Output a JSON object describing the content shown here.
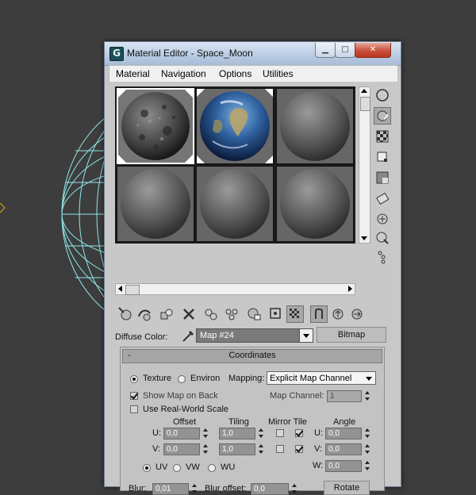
{
  "window": {
    "title": "Material Editor - Space_Moon",
    "icon_name": "3ds-max-app-icon"
  },
  "menu": [
    "Material",
    "Navigation",
    "Options",
    "Utilities"
  ],
  "slots": [
    {
      "kind": "moon",
      "selected": true
    },
    {
      "kind": "earth",
      "selected": false
    },
    {
      "kind": "gray",
      "selected": false
    },
    {
      "kind": "gray",
      "selected": false
    },
    {
      "kind": "gray",
      "selected": false
    },
    {
      "kind": "gray",
      "selected": false
    }
  ],
  "diffuse": {
    "label": "Diffuse Color:",
    "map_value": "Map #24",
    "bitmap_label": "Bitmap"
  },
  "coordinates": {
    "title": "Coordinates",
    "collapse_symbol": "-",
    "texture_label": "Texture",
    "environ_label": "Environ",
    "mapping_label": "Mapping:",
    "mapping_value": "Explicit Map Channel",
    "show_map_label": "Show Map on Back",
    "real_world_label": "Use Real-World Scale",
    "map_channel_label": "Map Channel:",
    "map_channel_value": "1",
    "headers": {
      "offset": "Offset",
      "tiling": "Tiling",
      "mirror_tile": "Mirror Tile",
      "angle": "Angle"
    },
    "u_label": "U:",
    "v_label": "V:",
    "w_label": "W:",
    "offset_u": "0,0",
    "offset_v": "0,0",
    "tiling_u": "1,0",
    "tiling_v": "1,0",
    "angle_u": "0,0",
    "angle_v": "0,0",
    "angle_w": "0,0",
    "mirror_u": false,
    "tile_u": true,
    "mirror_v": false,
    "tile_v": true,
    "uv_label": "UV",
    "vw_label": "VW",
    "wu_label": "WU",
    "blur_label": "Blur:",
    "blur_value": "0,01",
    "blur_offset_label": "Blur offset:",
    "blur_offset_value": "0,0",
    "rotate_label": "Rotate"
  },
  "toolbar_icons": [
    "get-material-icon",
    "put-to-scene-icon",
    "assign-to-selection-icon",
    "reset-map-icon",
    "copy-material-icon",
    "make-unique-icon",
    "put-to-library-icon",
    "material-id-channel-icon",
    "show-map-in-viewport-icon",
    "show-end-result-icon",
    "go-to-parent-icon",
    "go-forward-to-sibling-icon"
  ],
  "side_tools": [
    "sample-type-icon",
    "backlight-icon",
    "background-icon",
    "uv-tiling-icon",
    "video-color-check-icon",
    "make-preview-icon",
    "options-icon",
    "select-by-material-icon",
    "material-map-navigator-icon"
  ]
}
